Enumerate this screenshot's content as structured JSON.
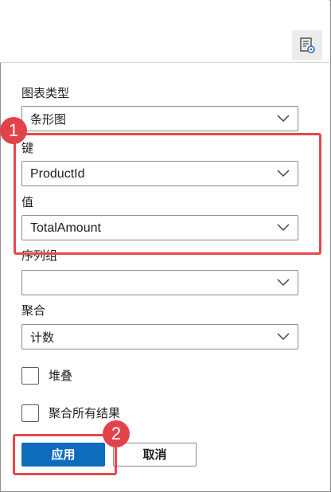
{
  "toolbar": {
    "icon": "chart-settings-icon"
  },
  "form": {
    "chart_type": {
      "label": "图表类型",
      "value": "条形图"
    },
    "key": {
      "label": "键",
      "value": "ProductId"
    },
    "value": {
      "label": "值",
      "value": "TotalAmount"
    },
    "series_group": {
      "label": "序列组",
      "value": ""
    },
    "aggregation": {
      "label": "聚合",
      "value": "计数"
    },
    "stacked": {
      "label": "堆叠",
      "checked": false
    },
    "aggregate_all": {
      "label": "聚合所有结果",
      "checked": false
    }
  },
  "buttons": {
    "apply": "应用",
    "cancel": "取消"
  },
  "annotations": {
    "badge1": "1",
    "badge2": "2",
    "color": "#e5484d"
  },
  "colors": {
    "primary": "#0f6cbd",
    "highlight": "#e5484d"
  }
}
